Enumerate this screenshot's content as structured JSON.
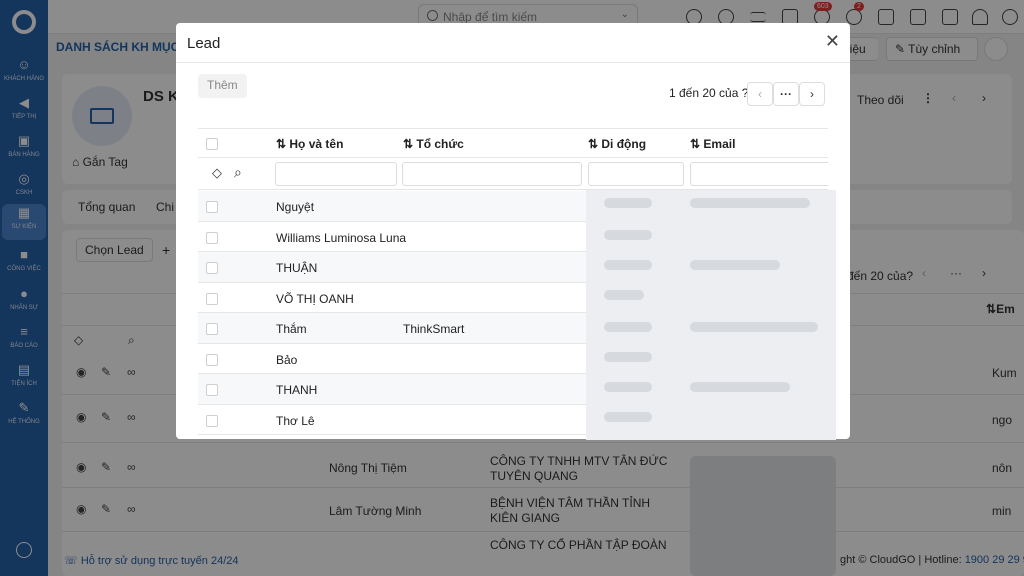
{
  "app": {
    "page_title": "DANH SÁCH KH MỤC"
  },
  "sidebar": {
    "items": [
      {
        "label": "KHÁCH HÀNG",
        "icon": "users-icon"
      },
      {
        "label": "TIẾP THỊ",
        "icon": "megaphone-icon"
      },
      {
        "label": "BÁN HÀNG",
        "icon": "cart-icon"
      },
      {
        "label": "CSKH",
        "icon": "support-icon"
      },
      {
        "label": "SỰ KIỆN",
        "icon": "calendar-icon"
      },
      {
        "label": "CÔNG VIỆC",
        "icon": "briefcase-icon"
      },
      {
        "label": "NHÂN SỰ",
        "icon": "person-icon"
      },
      {
        "label": "BÁO CÁO",
        "icon": "report-icon"
      },
      {
        "label": "TIỆN ÍCH",
        "icon": "box-icon"
      },
      {
        "label": "HỆ THỐNG",
        "icon": "wrench-icon"
      }
    ]
  },
  "topbar": {
    "search_placeholder": "Nhập để tìm kiếm",
    "notif_count": "603",
    "msg_count": "2"
  },
  "background": {
    "toolbar_data": "liệu",
    "toolbar_custom": "Tùy chỉnh",
    "record_title": "DS K",
    "tag_label": "Gắn Tag",
    "follow_label": "Theo dõi",
    "tab_overview": "Tổng quan",
    "tab_more": "Chi",
    "select_lead": "Chọn Lead",
    "pager_partial": "đến 20 của",
    "col_email_partial": "Em",
    "rows": [
      {
        "name": "",
        "org": "",
        "extra": "Kum"
      },
      {
        "name": "",
        "org": "",
        "extra": "ngo"
      },
      {
        "name": "Nông Thị Tiệm",
        "org": "CÔNG TY TNHH MTV TÂN ĐỨC TUYÊN QUANG",
        "extra": "nôn"
      },
      {
        "name": "Lâm Tường Minh",
        "org": "BỆNH VIỆN TÂM THẦN TỈNH KIÊN GIANG",
        "extra": "min"
      },
      {
        "name": "",
        "org": "CÔNG TY CỔ PHẦN TẬP ĐOÀN",
        "extra": ""
      }
    ],
    "footer_support": "Hỗ trợ sử dụng trực tuyến 24/24",
    "footer_copyright": "ght © CloudGO | Hotline: ",
    "footer_hotline": "1900 29 29 90"
  },
  "modal": {
    "title": "Lead",
    "add_button": "Thêm",
    "pager_text": "1 đến 20 của",
    "pager_unknown": "?",
    "columns": [
      "Họ và tên",
      "Tổ chức",
      "Di động",
      "Email"
    ],
    "rows": [
      {
        "name": "Nguyệt",
        "org": ""
      },
      {
        "name": "Williams Luminosa Luna",
        "org": ""
      },
      {
        "name": "THUẬN",
        "org": ""
      },
      {
        "name": "VÕ THỊ OANH",
        "org": ""
      },
      {
        "name": "Thắm",
        "org": "ThinkSmart"
      },
      {
        "name": "Bảo",
        "org": ""
      },
      {
        "name": "THANH",
        "org": ""
      },
      {
        "name": "Thơ Lê",
        "org": ""
      }
    ]
  },
  "colors": {
    "brand": "#2561a8",
    "badge": "#e53935"
  }
}
